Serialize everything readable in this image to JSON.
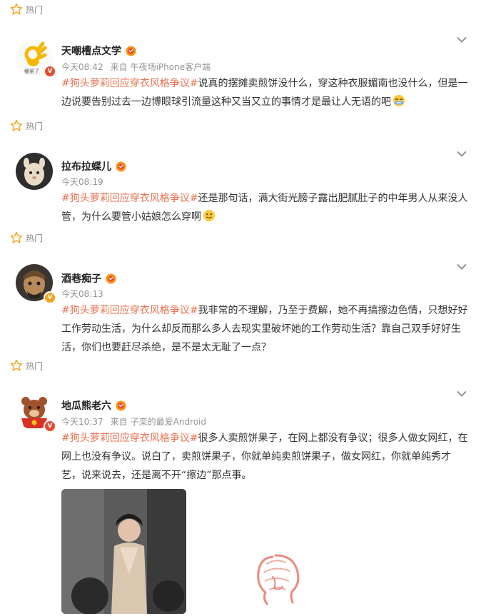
{
  "hot_label": "热门",
  "posts": [
    {
      "user": "天嘲槽点文学",
      "avatar_caption": "绷紧了",
      "time": "今天08:42",
      "source_prefix": "来自",
      "source": "午夜场iPhone客户端",
      "hashtag": "#狗头萝莉回应穿衣风格争议#",
      "text": "说真的摆摊卖煎饼没什么，穿这种衣服媚南也没什么，但是一边说要告别过去一边博眼球引流量这种又当又立的事情才是最让人无语的吧",
      "emoji": "speechless-face-emoji",
      "badge": "red"
    },
    {
      "user": "拉布拉蝶儿",
      "time": "今天08:19",
      "hashtag": "#狗头萝莉回应穿衣风格争议#",
      "text": "还是那句话，满大街光膀子露出肥腻肚子的中年男人从来没人管，为什么要管小姑娘怎么穿啊",
      "emoji": "smile-face-emoji"
    },
    {
      "user": "酒巷痴子",
      "time": "今天08:13",
      "hashtag": "#狗头萝莉回应穿衣风格争议#",
      "text": "我非常的不理解，乃至于费解，她不再搞擦边色情，只想好好工作劳动生活，为什么却反而那么多人去现实里破坏她的工作劳动生活？靠自己双手好好生活，你们也要赶尽杀绝，是不是太无耻了一点？",
      "badge": "gold"
    },
    {
      "user": "地瓜熊老六",
      "time": "今天10:37",
      "source_prefix": "来自",
      "source": "子栾的最爱Android",
      "hashtag": "#狗头萝莉回应穿衣风格争议#",
      "text": "很多人卖煎饼果子，在网上都没有争议；很多人做女网红，在网上也没有争议。说白了，卖煎饼果子，你就单纯卖煎饼果子，做女网红，你就单纯秀才艺，说来说去，还是离不开“擦边”那点事。",
      "badge": "red"
    }
  ],
  "colors": {
    "hashtag": "#eb7350",
    "name": "#222222",
    "meta": "#939393",
    "hot": "#8a8a8a"
  }
}
